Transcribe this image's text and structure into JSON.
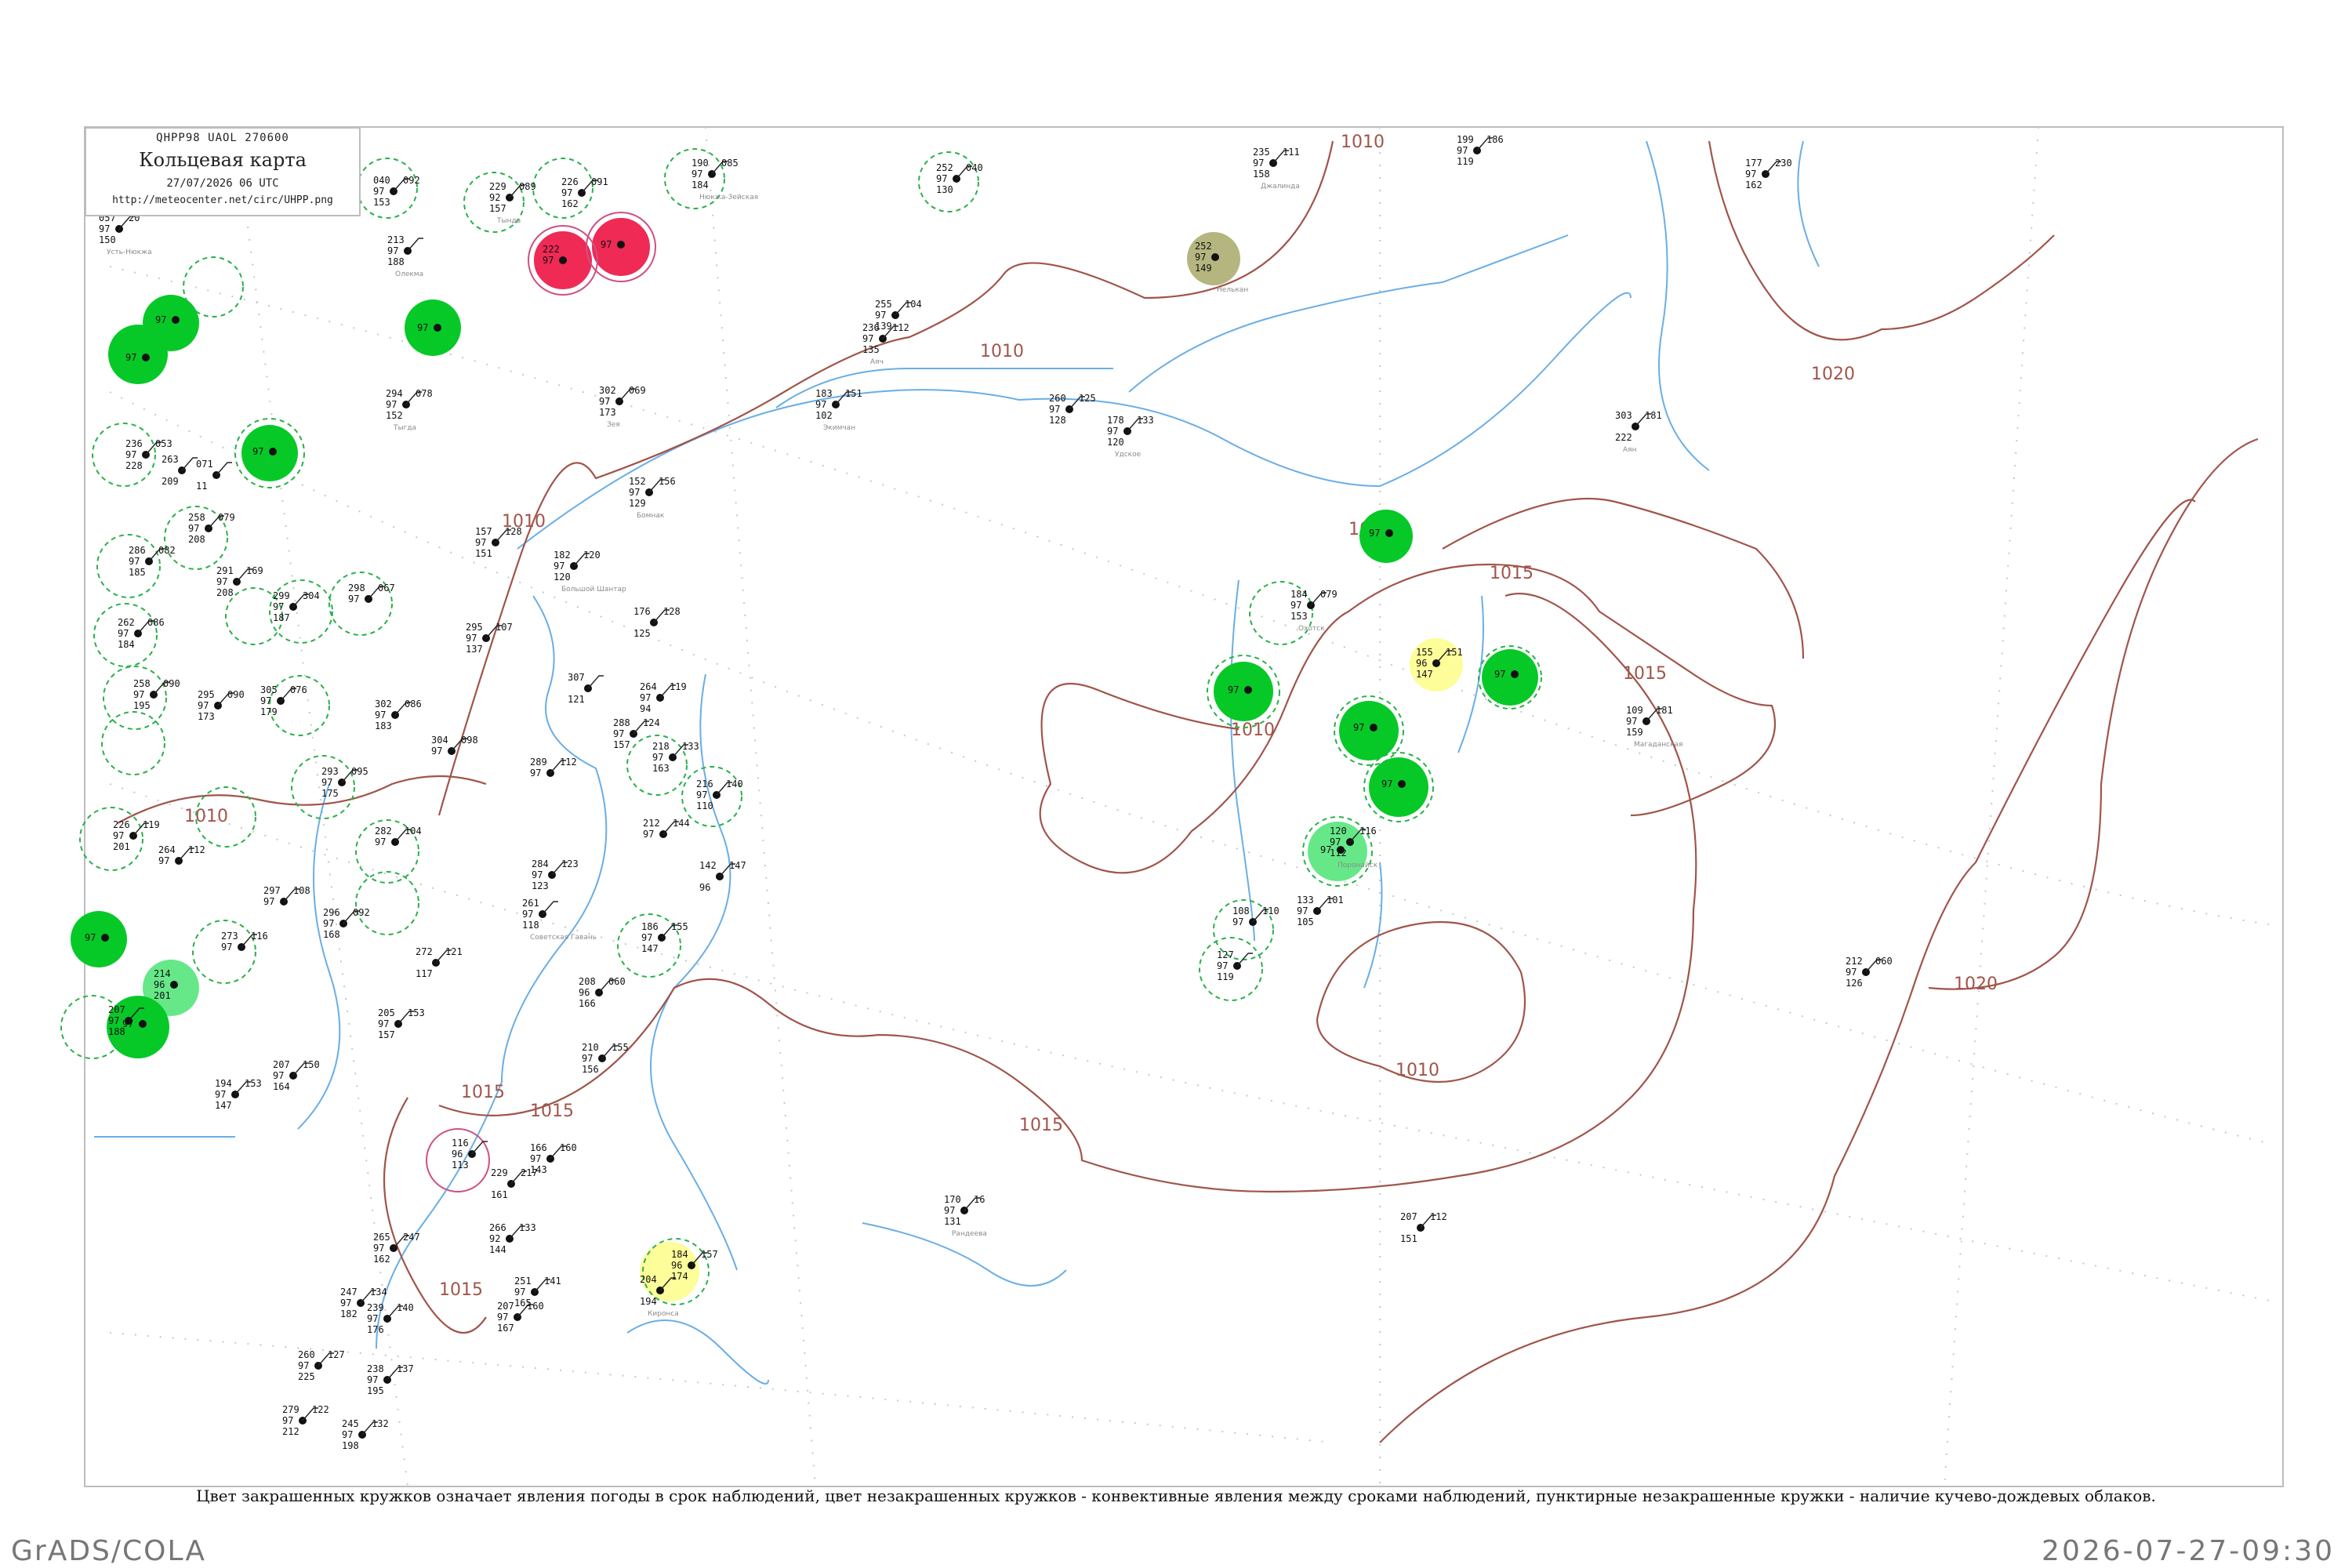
{
  "header": {
    "code_line": "QHPP98  UAOL  270600",
    "title": "Кольцевая карта",
    "datetime": "27/07/2026 06 UTC",
    "url": "http://meteocenter.net/circ/UHPP.png"
  },
  "caption": "Цвет закрашенных кружков означает явления погоды в срок наблюдений, цвет незакрашенных кружков - конвективные явления между сроками наблюдений, пунктирные незакрашенные кружки - наличие кучево-дождевых облаков.",
  "footer": {
    "left": "GrADS/COLA",
    "right": "2026-07-27-09:30"
  },
  "colors": {
    "isobar": "#a0554a",
    "river": "#6aaee6",
    "station_green": "#06c928",
    "station_light_green": "#66e888",
    "station_red": "#ee2a55",
    "station_yellow": "#fdfd9a",
    "station_olive": "#b5b580",
    "cb_dashed": "#2ab04a",
    "convective_ring": "#d05080"
  },
  "isobars": [
    {
      "label": "1010"
    },
    {
      "label": "1015"
    },
    {
      "label": "1020"
    }
  ],
  "stations": [
    {
      "id": "st-01",
      "t": "057",
      "v": "97",
      "p": "150",
      "d": "20",
      "name": "Усть-Нюкжа"
    },
    {
      "id": "st-02",
      "t": "040",
      "v": "97",
      "p": "153",
      "d": "092",
      "name": ""
    },
    {
      "id": "st-03",
      "t": "213",
      "v": "97",
      "p": "188",
      "d": "",
      "name": "Олекма"
    },
    {
      "id": "st-04",
      "t": "229",
      "v": "92",
      "p": "157",
      "d": "089",
      "name": "Тында"
    },
    {
      "id": "st-05",
      "t": "226",
      "v": "97",
      "p": "162",
      "d": "091",
      "name": ""
    },
    {
      "id": "st-06",
      "t": "190",
      "v": "97",
      "p": "184",
      "d": "085",
      "name": "Нюкжа-Зейская"
    },
    {
      "id": "st-07",
      "t": "252",
      "v": "97",
      "p": "130",
      "d": "040",
      "name": ""
    },
    {
      "id": "st-08",
      "t": "235",
      "v": "97",
      "p": "158",
      "d": "111",
      "name": "Джалинда"
    },
    {
      "id": "st-09",
      "t": "199",
      "v": "97",
      "p": "119",
      "d": "186",
      "name": ""
    },
    {
      "id": "st-10",
      "t": "177",
      "v": "97",
      "p": "162",
      "d": "230",
      "name": ""
    },
    {
      "id": "st-11",
      "t": "294",
      "v": "97",
      "p": "152",
      "d": "078",
      "name": "Тыгда"
    },
    {
      "id": "st-12",
      "t": "302",
      "v": "97",
      "p": "173",
      "d": "069",
      "name": "Зея"
    },
    {
      "id": "st-13",
      "t": "255",
      "v": "97",
      "p": "139",
      "d": "104",
      "name": ""
    },
    {
      "id": "st-14",
      "t": "236",
      "v": "97",
      "p": "135",
      "d": "112",
      "name": "Аяч"
    },
    {
      "id": "st-15",
      "t": "183",
      "v": "97",
      "p": "102",
      "d": "151",
      "name": "Экимчан"
    },
    {
      "id": "st-16",
      "t": "260",
      "v": "97",
      "p": "128",
      "d": "125",
      "name": ""
    },
    {
      "id": "st-17",
      "t": "178",
      "v": "97",
      "p": "120",
      "d": "133",
      "name": "Удское"
    },
    {
      "id": "st-18",
      "t": "303",
      "v": "",
      "p": "222",
      "d": "181",
      "name": "Аян"
    },
    {
      "id": "st-19",
      "t": "236",
      "v": "97",
      "p": "228",
      "d": "053",
      "name": ""
    },
    {
      "id": "st-20",
      "t": "263",
      "v": "",
      "p": "209",
      "d": "",
      "name": ""
    },
    {
      "id": "st-21",
      "t": "071",
      "v": "",
      "p": "11",
      "d": "",
      "name": ""
    },
    {
      "id": "st-22",
      "t": "258",
      "v": "97",
      "p": "208",
      "d": "079",
      "name": ""
    },
    {
      "id": "st-23",
      "t": "152",
      "v": "97",
      "p": "129",
      "d": "156",
      "name": "Бомнак"
    },
    {
      "id": "st-24",
      "t": "157",
      "v": "97",
      "p": "151",
      "d": "128",
      "name": ""
    },
    {
      "id": "st-25",
      "t": "182",
      "v": "97",
      "p": "120",
      "d": "120",
      "name": "Большой Шантар"
    },
    {
      "id": "st-26",
      "t": "286",
      "v": "97",
      "p": "185",
      "d": "082",
      "name": ""
    },
    {
      "id": "st-27",
      "t": "291",
      "v": "97",
      "p": "208",
      "d": "169",
      "name": ""
    },
    {
      "id": "st-28",
      "t": "299",
      "v": "97",
      "p": "187",
      "d": "304",
      "name": ""
    },
    {
      "id": "st-29",
      "t": "298",
      "v": "97",
      "p": "",
      "d": "067",
      "name": ""
    },
    {
      "id": "st-30",
      "t": "262",
      "v": "97",
      "p": "184",
      "d": "086",
      "name": ""
    },
    {
      "id": "st-31",
      "t": "295",
      "v": "97",
      "p": "137",
      "d": "107",
      "name": ""
    },
    {
      "id": "st-32",
      "t": "176",
      "v": "",
      "p": "125",
      "d": "128",
      "name": ""
    },
    {
      "id": "st-33",
      "t": "184",
      "v": "97",
      "p": "153",
      "d": "079",
      "name": "Охотск"
    },
    {
      "id": "st-34",
      "t": "155",
      "v": "96",
      "p": "147",
      "d": "151",
      "name": ""
    },
    {
      "id": "st-35",
      "t": "258",
      "v": "97",
      "p": "195",
      "d": "090",
      "name": ""
    },
    {
      "id": "st-36",
      "t": "295",
      "v": "97",
      "p": "173",
      "d": "090",
      "name": ""
    },
    {
      "id": "st-37",
      "t": "305",
      "v": "97",
      "p": "179",
      "d": "076",
      "name": ""
    },
    {
      "id": "st-38",
      "t": "307",
      "v": "",
      "p": "121",
      "d": "",
      "name": ""
    },
    {
      "id": "st-39",
      "t": "264",
      "v": "97",
      "p": "94",
      "d": "119",
      "name": ""
    },
    {
      "id": "st-40",
      "t": "109",
      "v": "97",
      "p": "159",
      "d": "181",
      "name": "Магаданская"
    },
    {
      "id": "st-41",
      "t": "302",
      "v": "97",
      "p": "183",
      "d": "086",
      "name": ""
    },
    {
      "id": "st-42",
      "t": "304",
      "v": "97",
      "p": "",
      "d": "098",
      "name": ""
    },
    {
      "id": "st-43",
      "t": "288",
      "v": "97",
      "p": "157",
      "d": "124",
      "name": ""
    },
    {
      "id": "st-44",
      "t": "218",
      "v": "97",
      "p": "163",
      "d": "133",
      "name": ""
    },
    {
      "id": "st-45",
      "t": "216",
      "v": "97",
      "p": "110",
      "d": "140",
      "name": ""
    },
    {
      "id": "st-46",
      "t": "293",
      "v": "97",
      "p": "175",
      "d": "095",
      "name": ""
    },
    {
      "id": "st-47",
      "t": "289",
      "v": "97",
      "p": "",
      "d": "112",
      "name": ""
    },
    {
      "id": "st-48",
      "t": "212",
      "v": "97",
      "p": "",
      "d": "144",
      "name": ""
    },
    {
      "id": "st-49",
      "t": "142",
      "v": "",
      "p": "96",
      "d": "147",
      "name": ""
    },
    {
      "id": "st-50",
      "t": "226",
      "v": "97",
      "p": "201",
      "d": "119",
      "name": ""
    },
    {
      "id": "st-51",
      "t": "264",
      "v": "97",
      "p": "",
      "d": "112",
      "name": ""
    },
    {
      "id": "st-52",
      "t": "282",
      "v": "97",
      "p": "",
      "d": "104",
      "name": ""
    },
    {
      "id": "st-53",
      "t": "297",
      "v": "97",
      "p": "",
      "d": "108",
      "name": ""
    },
    {
      "id": "st-54",
      "t": "284",
      "v": "97",
      "p": "123",
      "d": "123",
      "name": ""
    },
    {
      "id": "st-55",
      "t": "261",
      "v": "97",
      "p": "118",
      "d": "",
      "name": "Советская Гавань"
    },
    {
      "id": "st-56",
      "t": "186",
      "v": "97",
      "p": "147",
      "d": "155",
      "name": ""
    },
    {
      "id": "st-57",
      "t": "120",
      "v": "97",
      "p": "112",
      "d": "116",
      "name": "Поронайск"
    },
    {
      "id": "st-58",
      "t": "133",
      "v": "97",
      "p": "105",
      "d": "101",
      "name": ""
    },
    {
      "id": "st-59",
      "t": "108",
      "v": "97",
      "p": "",
      "d": "110",
      "name": ""
    },
    {
      "id": "st-60",
      "t": "127",
      "v": "97",
      "p": "119",
      "d": "",
      "name": ""
    },
    {
      "id": "st-61",
      "t": "296",
      "v": "97",
      "p": "168",
      "d": "092",
      "name": ""
    },
    {
      "id": "st-62",
      "t": "273",
      "v": "97",
      "p": "",
      "d": "116",
      "name": ""
    },
    {
      "id": "st-63",
      "t": "272",
      "v": "",
      "p": "117",
      "d": "121",
      "name": ""
    },
    {
      "id": "st-64",
      "t": "208",
      "v": "96",
      "p": "166",
      "d": "060",
      "name": ""
    },
    {
      "id": "st-65",
      "t": "207",
      "v": "97",
      "p": "188",
      "d": "",
      "name": ""
    },
    {
      "id": "st-66",
      "t": "205",
      "v": "97",
      "p": "157",
      "d": "153",
      "name": ""
    },
    {
      "id": "st-67",
      "t": "210",
      "v": "97",
      "p": "156",
      "d": "155",
      "name": ""
    },
    {
      "id": "st-68",
      "t": "194",
      "v": "97",
      "p": "147",
      "d": "153",
      "name": ""
    },
    {
      "id": "st-69",
      "t": "207",
      "v": "97",
      "p": "164",
      "d": "150",
      "name": ""
    },
    {
      "id": "st-70",
      "t": "116",
      "v": "96",
      "p": "113",
      "d": "",
      "name": ""
    },
    {
      "id": "st-71",
      "t": "229",
      "v": "",
      "p": "161",
      "d": "217",
      "name": ""
    },
    {
      "id": "st-72",
      "t": "166",
      "v": "97",
      "p": "143",
      "d": "160",
      "name": ""
    },
    {
      "id": "st-73",
      "t": "184",
      "v": "96",
      "p": "174",
      "d": "157",
      "name": ""
    },
    {
      "id": "st-74",
      "t": "170",
      "v": "97",
      "p": "131",
      "d": "16",
      "name": "Рандеева"
    },
    {
      "id": "st-75",
      "t": "207",
      "v": "",
      "p": "151",
      "d": "112",
      "name": ""
    },
    {
      "id": "st-76",
      "t": "212",
      "v": "97",
      "p": "126",
      "d": "060",
      "name": ""
    },
    {
      "id": "st-77",
      "t": "265",
      "v": "97",
      "p": "162",
      "d": "247",
      "name": ""
    },
    {
      "id": "st-78",
      "t": "266",
      "v": "92",
      "p": "144",
      "d": "133",
      "name": ""
    },
    {
      "id": "st-79",
      "t": "251",
      "v": "97",
      "p": "165",
      "d": "141",
      "name": ""
    },
    {
      "id": "st-80",
      "t": "247",
      "v": "97",
      "p": "182",
      "d": "134",
      "name": ""
    },
    {
      "id": "st-81",
      "t": "239",
      "v": "97",
      "p": "176",
      "d": "140",
      "name": ""
    },
    {
      "id": "st-82",
      "t": "207",
      "v": "97",
      "p": "167",
      "d": "160",
      "name": ""
    },
    {
      "id": "st-83",
      "t": "204",
      "v": "",
      "p": "194",
      "d": "",
      "name": "Киронса"
    },
    {
      "id": "st-84",
      "t": "260",
      "v": "97",
      "p": "225",
      "d": "127",
      "name": ""
    },
    {
      "id": "st-85",
      "t": "238",
      "v": "97",
      "p": "195",
      "d": "137",
      "name": ""
    },
    {
      "id": "st-86",
      "t": "279",
      "v": "97",
      "p": "212",
      "d": "122",
      "name": ""
    },
    {
      "id": "st-87",
      "t": "245",
      "v": "97",
      "p": "198",
      "d": "132",
      "name": ""
    }
  ],
  "stations_filled": [
    {
      "id": "st-f1",
      "t": "222",
      "v": "97",
      "p": "",
      "kind": "red",
      "name": ""
    },
    {
      "id": "st-f2",
      "t": "",
      "v": "97",
      "p": "",
      "kind": "red",
      "name": ""
    },
    {
      "id": "st-f3",
      "t": "252",
      "v": "97",
      "p": "149",
      "kind": "olive",
      "name": "Нелькан"
    },
    {
      "id": "st-f4",
      "t": "",
      "v": "97",
      "p": "",
      "kind": "green",
      "name": ""
    },
    {
      "id": "st-f5",
      "t": "",
      "v": "97",
      "p": "",
      "kind": "green",
      "name": ""
    },
    {
      "id": "st-f6",
      "t": "",
      "v": "97",
      "p": "",
      "kind": "green",
      "name": ""
    },
    {
      "id": "st-f7",
      "t": "",
      "v": "97",
      "p": "",
      "kind": "green",
      "name": ""
    },
    {
      "id": "st-f8",
      "t": "",
      "v": "97",
      "p": "",
      "kind": "green",
      "name": ""
    },
    {
      "id": "st-f9",
      "t": "",
      "v": "97",
      "p": "",
      "kind": "green",
      "name": ""
    },
    {
      "id": "st-f10",
      "t": "",
      "v": "97",
      "p": "",
      "kind": "green",
      "name": ""
    },
    {
      "id": "st-f11",
      "t": "",
      "v": "97",
      "p": "",
      "kind": "green",
      "name": ""
    },
    {
      "id": "st-f12",
      "t": "",
      "v": "97",
      "p": "",
      "kind": "green",
      "name": ""
    },
    {
      "id": "st-f13",
      "t": "",
      "v": "97",
      "p": "",
      "kind": "green",
      "name": ""
    },
    {
      "id": "st-f14",
      "t": "214",
      "v": "96",
      "p": "201",
      "kind": "lightgreen",
      "name": ""
    },
    {
      "id": "st-f15",
      "t": "",
      "v": "97",
      "p": "",
      "kind": "green",
      "name": ""
    },
    {
      "id": "st-f16",
      "t": "",
      "v": "97",
      "p": "",
      "kind": "green",
      "name": ""
    }
  ]
}
